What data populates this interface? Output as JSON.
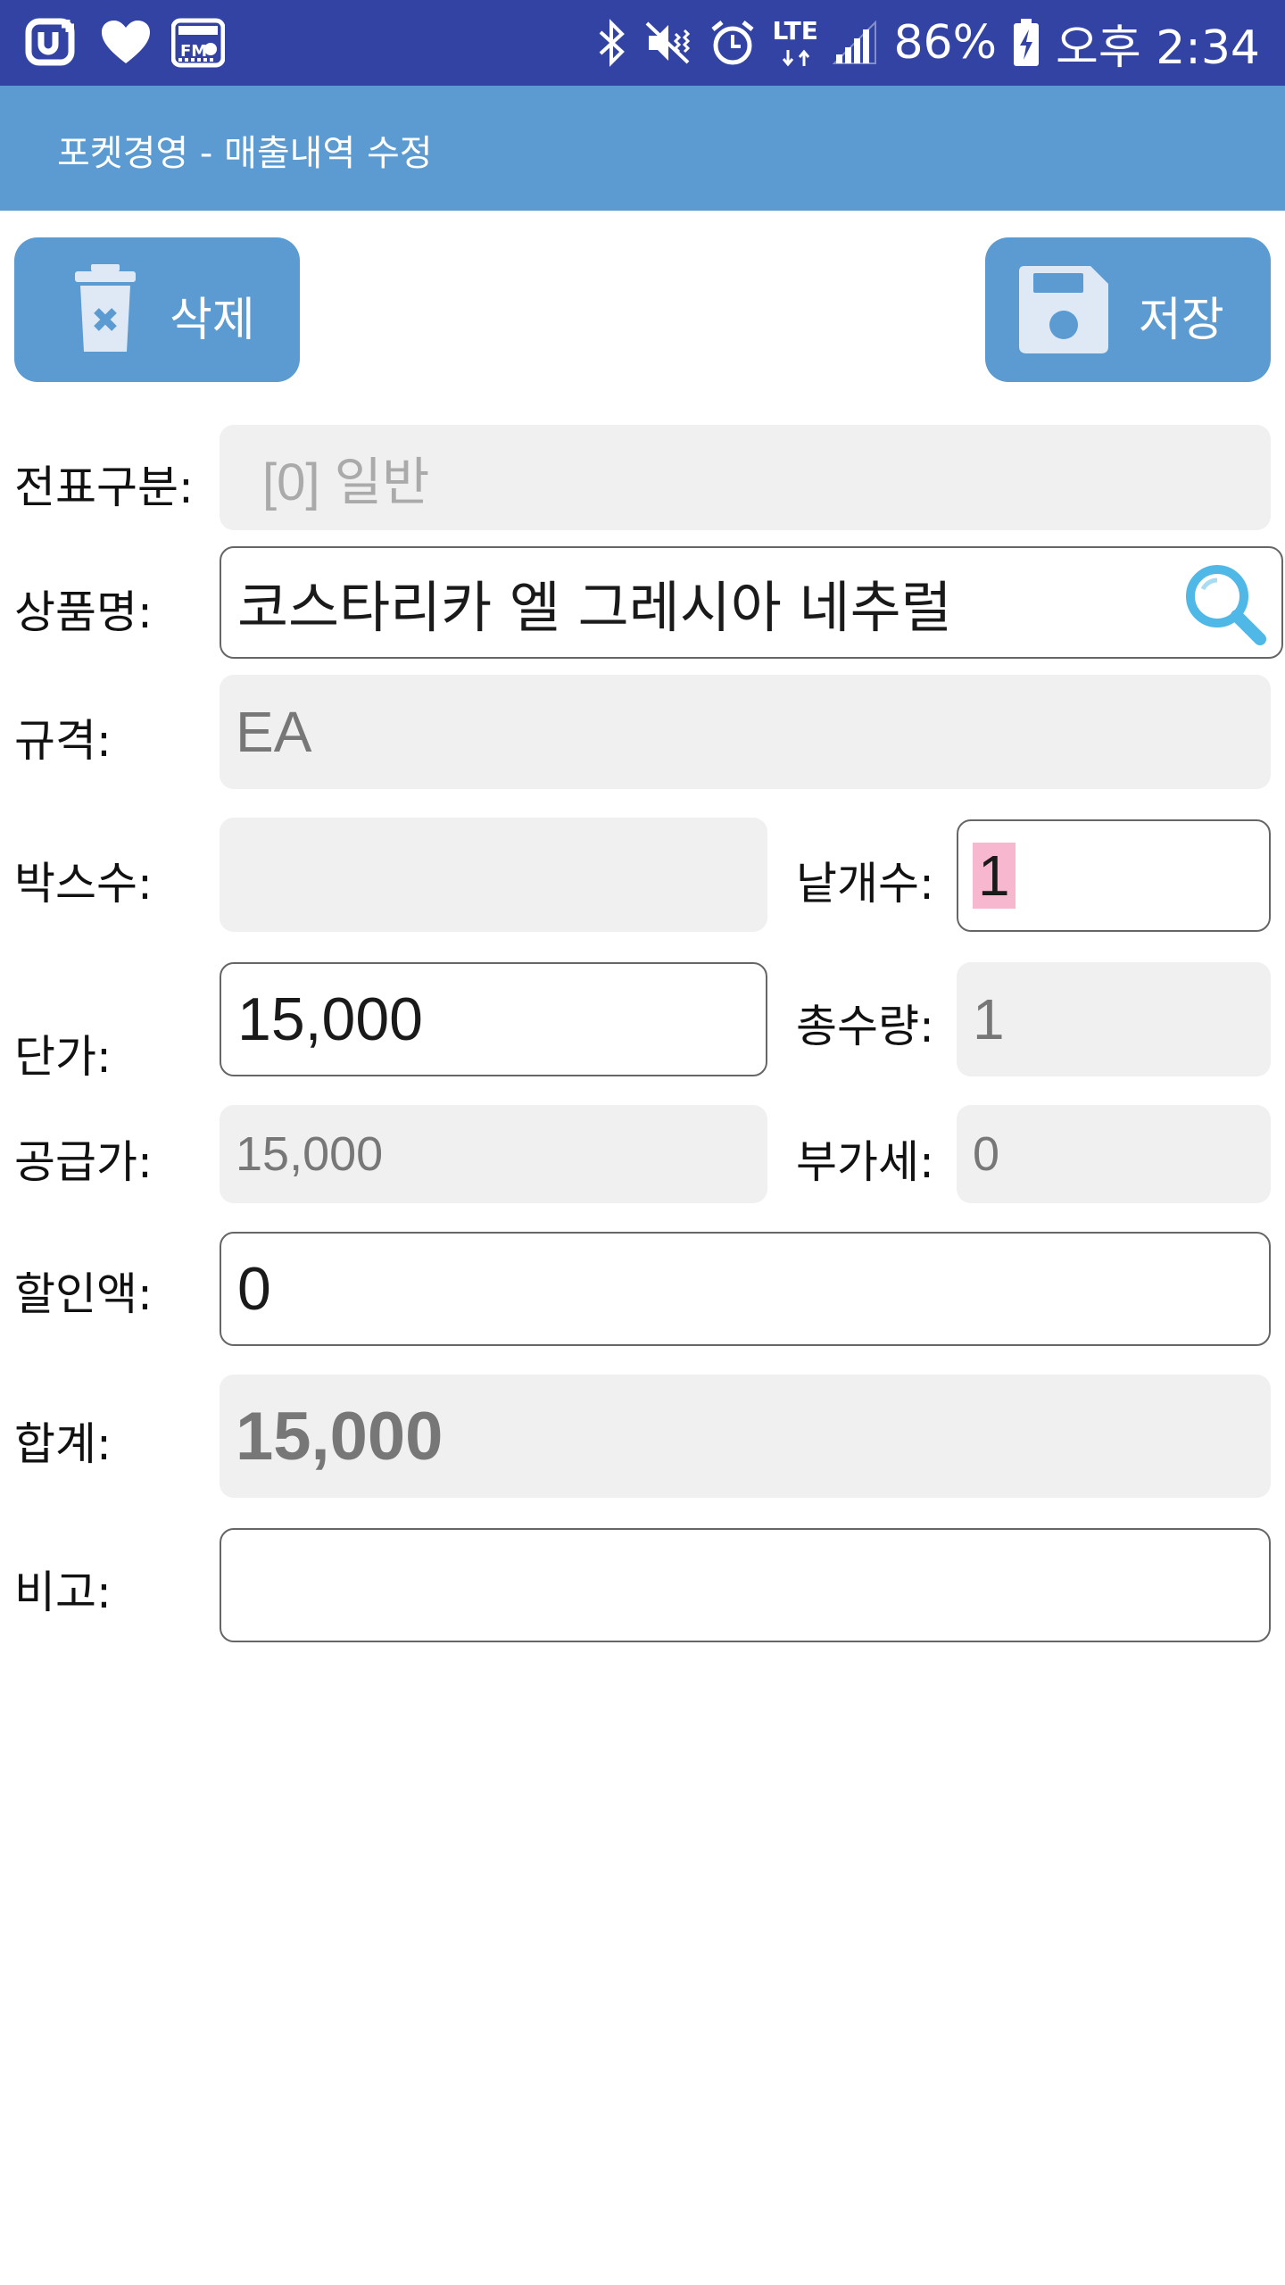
{
  "status_bar": {
    "left_icons": [
      "u-plus-icon",
      "heart-icon",
      "fm-radio-icon"
    ],
    "fm_label": "FM",
    "network": "LTE",
    "battery": "86%",
    "time": "오후 2:34",
    "bg_color": "#3243a3"
  },
  "app_bar": {
    "title": "포켓경영 - 매출내역 수정",
    "bg_color": "#5b9bd1"
  },
  "actions": {
    "delete_label": "삭제",
    "save_label": "저장"
  },
  "form": {
    "slip_type": {
      "label": "전표구분:",
      "value": "[0] 일반"
    },
    "product": {
      "label": "상품명:",
      "value": "코스타리카 엘 그레시아 네추럴"
    },
    "spec": {
      "label": "규격:",
      "value": "EA"
    },
    "box_count": {
      "label": "박스수:",
      "value": ""
    },
    "unit_count": {
      "label": "낱개수:",
      "value": "1"
    },
    "unit_price": {
      "label": "단가:",
      "value": "15,000"
    },
    "total_qty": {
      "label": "총수량:",
      "value": "1"
    },
    "supply_price": {
      "label": "공급가:",
      "value": "15,000"
    },
    "vat": {
      "label": "부가세:",
      "value": "0"
    },
    "discount": {
      "label": "할인액:",
      "value": "0"
    },
    "total": {
      "label": "합계:",
      "value": "15,000"
    },
    "memo": {
      "label": "비고:",
      "value": ""
    }
  },
  "colors": {
    "accent": "#5b9bd1",
    "search_icon": "#4fb8e6",
    "selection": "#f7b8cf",
    "readonly_bg": "#f0f0f0"
  }
}
